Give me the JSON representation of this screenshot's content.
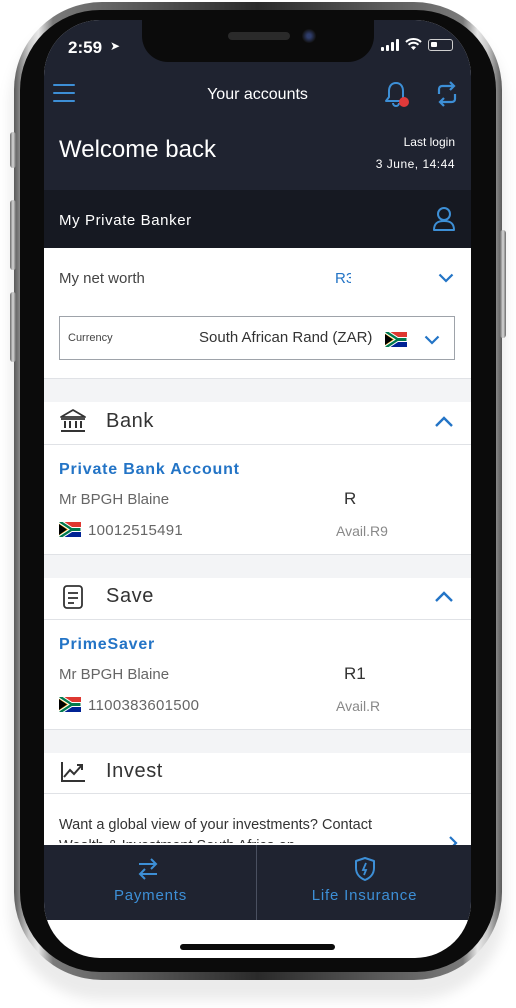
{
  "status_bar": {
    "time": "2:59"
  },
  "header": {
    "title": "Your accounts"
  },
  "welcome": {
    "greeting": "Welcome back",
    "last_login_label": "Last login",
    "last_login_date": "3 June, 14:44"
  },
  "banker": {
    "label": "My Private Banker"
  },
  "net_worth": {
    "label": "My net worth",
    "value": "R3"
  },
  "currency": {
    "label": "Currency",
    "value": "South African Rand (ZAR)"
  },
  "sections": {
    "bank": {
      "title": "Bank",
      "account_name": "Private Bank Account",
      "holder": "Mr BPGH Blaine",
      "account_number": "10012515491",
      "amount": "R",
      "available": "Avail.R9"
    },
    "save": {
      "title": "Save",
      "account_name": "PrimeSaver",
      "holder": "Mr BPGH Blaine",
      "account_number": "1100383601500",
      "amount": "R1",
      "available": "Avail.R"
    },
    "invest": {
      "title": "Invest",
      "message": "Want a global view of your investments? Contact Wealth & Investment South Africa on"
    }
  },
  "tabbar": {
    "payments": "Payments",
    "life_insurance": "Life Insurance"
  },
  "colors": {
    "header_bg": "#1f2330",
    "banker_bg": "#161922",
    "accent_blue": "#2374c6",
    "notification_red": "#e03a3a"
  },
  "icons": [
    "menu-icon",
    "bell-icon",
    "sync-icon",
    "person-icon",
    "chevron-down-icon",
    "chevron-up-icon",
    "bank-icon",
    "save-icon",
    "invest-chart-icon",
    "transfer-icon",
    "shield-icon",
    "flag-za-icon"
  ]
}
